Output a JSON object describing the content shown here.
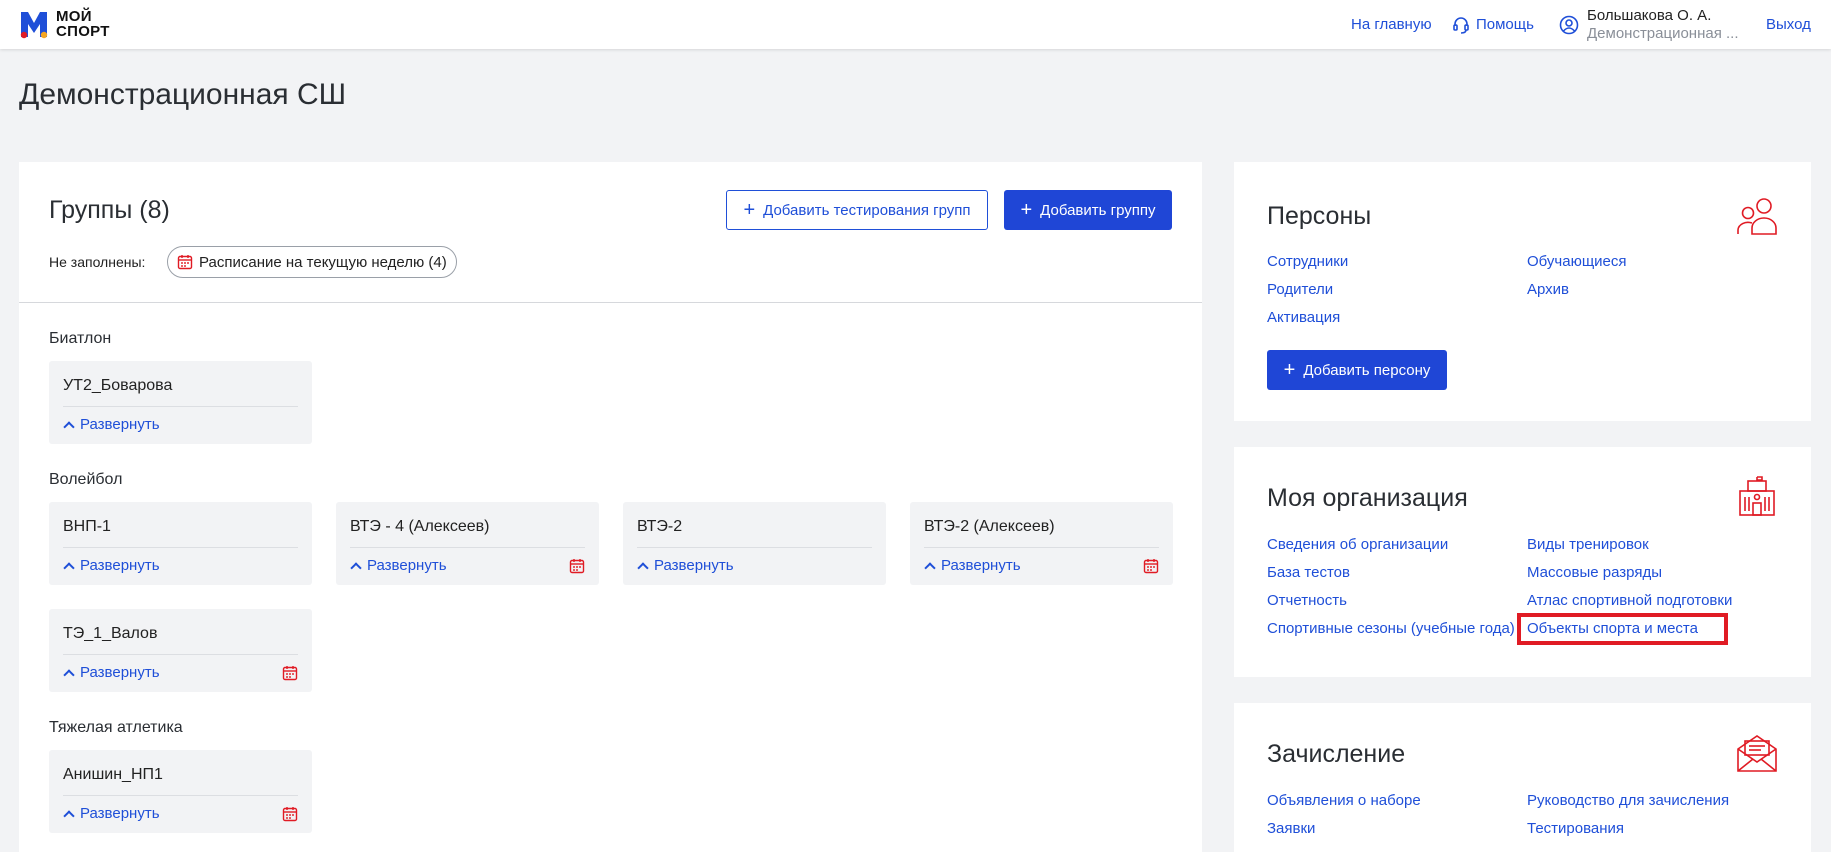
{
  "header": {
    "logo_line1": "МОЙ",
    "logo_line2": "СПОРТ",
    "nav_home": "На главную",
    "nav_help": "Помощь",
    "user_name": "Большакова О. А.",
    "user_org": "Демонстрационная ...",
    "nav_exit": "Выход"
  },
  "page": {
    "title": "Демонстрационная СШ"
  },
  "groups": {
    "title": "Группы (8)",
    "add_tests_label": "Добавить тестирования групп",
    "add_group_label": "Добавить группу",
    "unfilled_label": "Не заполнены:",
    "unfilled_chip": "Расписание на текущую неделю (4)",
    "expand_label": "Развернуть",
    "sports": [
      {
        "name": "Биатлон",
        "cards": [
          {
            "title": "УТ2_Боварова",
            "calendar": false
          }
        ]
      },
      {
        "name": "Волейбол",
        "cards": [
          {
            "title": "ВНП-1",
            "calendar": false
          },
          {
            "title": "ВТЭ - 4 (Алексеев)",
            "calendar": true
          },
          {
            "title": "ВТЭ-2",
            "calendar": false
          },
          {
            "title": "ВТЭ-2 (Алексеев)",
            "calendar": true
          },
          {
            "title": "ТЭ_1_Валов",
            "calendar": true
          }
        ]
      },
      {
        "name": "Тяжелая атлетика",
        "cards": [
          {
            "title": "Анишин_НП1",
            "calendar": true
          }
        ]
      }
    ]
  },
  "persons": {
    "title": "Персоны",
    "links": [
      "Сотрудники",
      "Обучающиеся",
      "Родители",
      "Архив",
      "Активация"
    ],
    "add_label": "Добавить персону"
  },
  "organization": {
    "title": "Моя организация",
    "links": [
      "Сведения об организации",
      "Виды тренировок",
      "База тестов",
      "Массовые разряды",
      "Отчетность",
      "Атлас спортивной подготовки",
      "Спортивные сезоны (учебные года)",
      "Объекты спорта и места"
    ]
  },
  "enrollment": {
    "title": "Зачисление",
    "links": [
      "Объявления о наборе",
      "Руководство для зачисления",
      "Заявки",
      "Тестирования"
    ]
  },
  "colors": {
    "accent": "#1f46d6",
    "link": "#1f4fd8",
    "icon_red": "#e01b24",
    "logo_blue": "#1f4fd8",
    "logo_red": "#e01b24"
  },
  "icons": [
    "logo-icon",
    "headset-icon",
    "user-circle-icon",
    "plus-icon",
    "calendar-icon",
    "chevron-up-icon",
    "persons-icon",
    "building-icon",
    "envelope-icon"
  ]
}
